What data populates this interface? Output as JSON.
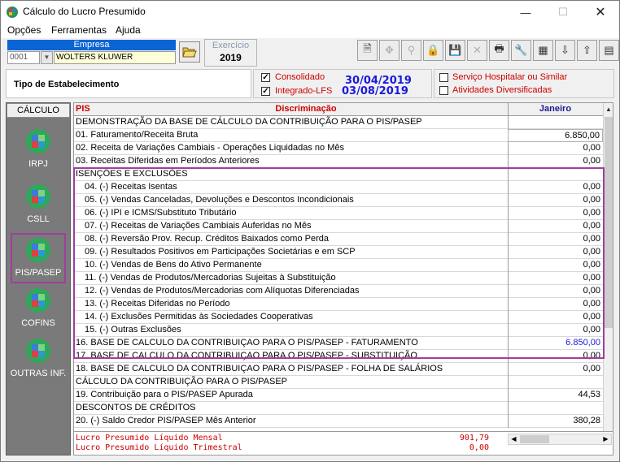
{
  "window": {
    "title": "Cálculo do Lucro Presumido",
    "minimize_icon": "minimize-icon",
    "maximize_icon": "maximize-icon",
    "close_icon": "close-icon"
  },
  "menu": {
    "items": [
      "Opções",
      "Ferramentas",
      "Ajuda"
    ]
  },
  "empresa": {
    "label": "Empresa",
    "code": "0001",
    "name": "WOLTERS KLUWER"
  },
  "exercicio": {
    "label": "Exercício",
    "value": "2019"
  },
  "tipo": {
    "label": "Tipo de Estabelecimento"
  },
  "options": {
    "consolidado_label": "Consolidado",
    "consolidado_date": "30/04/2019",
    "integrado_label": "Integrado-LFS",
    "integrado_date": "03/08/2019",
    "hospitalar_label": "Serviço Hospitalar ou Similar",
    "atividades_label": "Atividades Diversificadas"
  },
  "nav": {
    "header": "CÁLCULO",
    "items": [
      "IRPJ",
      "CSLL",
      "PIS/PASEP",
      "COFINS",
      "OUTRAS INF."
    ]
  },
  "grid": {
    "col_pis": "PIS",
    "col_disc": "Discriminação",
    "col_month": "Janeiro",
    "rows": [
      {
        "desc": "DEMONSTRAÇÃO DA BASE DE CÁLCULO DA CONTRIBUIÇÃO PARA O PIS/PASEP",
        "val": ""
      },
      {
        "desc": "01. Faturamento/Receita Bruta",
        "val": "6.850,00"
      },
      {
        "desc": "02. Receita de Variações Cambiais - Operações Liquidadas no Mês",
        "val": "0,00"
      },
      {
        "desc": "03. Receitas Diferidas em Períodos Anteriores",
        "val": "0,00"
      },
      {
        "desc": "ISENÇÕES E EXCLUSÕES",
        "val": ""
      },
      {
        "desc": "04. (-) Receitas Isentas",
        "val": "0,00"
      },
      {
        "desc": "05. (-) Vendas Canceladas, Devoluções e Descontos Incondicionais",
        "val": "0,00"
      },
      {
        "desc": "06. (-) IPI e ICMS/Substituto Tributário",
        "val": "0,00"
      },
      {
        "desc": "07. (-) Receitas de Variações Cambiais Auferidas no Mês",
        "val": "0,00"
      },
      {
        "desc": "08. (-) Reversão Prov. Recup. Créditos Baixados como Perda",
        "val": "0,00"
      },
      {
        "desc": "09. (-) Resultados Positivos em Participações Societárias e em SCP",
        "val": "0,00"
      },
      {
        "desc": "10. (-) Vendas de Bens do Ativo Permanente",
        "val": "0,00"
      },
      {
        "desc": "11. (-) Vendas de Produtos/Mercadorias Sujeitas à Substituição",
        "val": "0,00"
      },
      {
        "desc": "12. (-) Vendas de Produtos/Mercadorias com Alíquotas Diferenciadas",
        "val": "0,00"
      },
      {
        "desc": "13. (-) Receitas Diferidas no Período",
        "val": "0,00"
      },
      {
        "desc": "14. (-) Exclusões Permitidas às Sociedades Cooperativas",
        "val": "0,00"
      },
      {
        "desc": "15. (-) Outras Exclusões",
        "val": "0,00"
      },
      {
        "desc": "16. BASE DE CALCULO DA CONTRIBUIÇAO PARA O PIS/PASEP - FATURAMENTO",
        "val": "6.850,00"
      },
      {
        "desc": "17. BASE DE CALCULO DA CONTRIBUIÇAO PARA O PIS/PASEP - SUBSTITUIÇÃO",
        "val": "0,00"
      },
      {
        "desc": "18. BASE DE CALCULO DA CONTRIBUIÇAO PARA O PIS/PASEP - FOLHA DE SALÁRIOS",
        "val": "0,00"
      },
      {
        "desc": "CÁLCULO DA CONTRIBUIÇÃO PARA O PIS/PASEP",
        "val": ""
      },
      {
        "desc": "19. Contribuição para o PIS/PASEP Apurada",
        "val": "44,53"
      },
      {
        "desc": "DESCONTOS DE CRÉDITOS",
        "val": ""
      },
      {
        "desc": "20. (-) Saldo Credor PIS/PASEP Mês Anterior",
        "val": "380,28"
      }
    ]
  },
  "footer": {
    "mensal_label": "Lucro Presumido Líquido Mensal",
    "mensal_value": "901,79",
    "trimestral_label": "Lucro Presumido Líquido Trimestral",
    "trimestral_value": "0,00"
  },
  "colors": {
    "accent_red": "#cc0000",
    "date_blue": "#1a1adc",
    "highlight_purple": "#a03ea0",
    "empresa_blue": "#0a64d6"
  }
}
